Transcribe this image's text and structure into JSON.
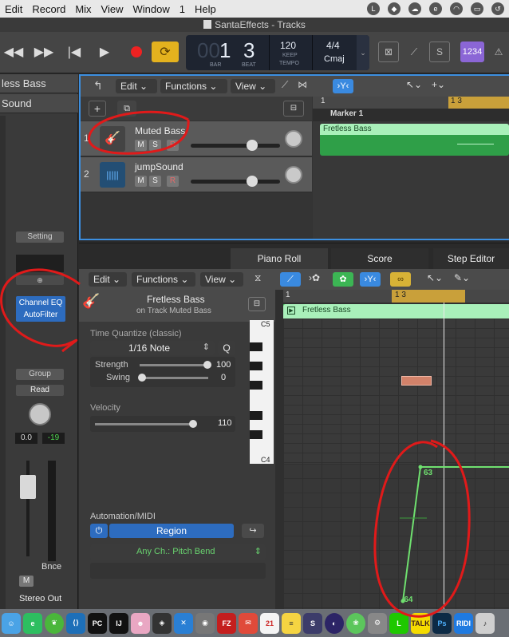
{
  "menubar": {
    "items": [
      "Edit",
      "Record",
      "Mix",
      "View",
      "Window",
      "1",
      "Help"
    ]
  },
  "window": {
    "title": "SantaEffects - Tracks"
  },
  "transport": {
    "bar_dim": "00",
    "bar": "1",
    "beat": "3",
    "bar_label": "BAR",
    "beat_label": "BEAT",
    "tempo": "120",
    "keep": "KEEP",
    "tempo_label": "TEMPO",
    "signature": "4/4",
    "key": "Cmaj",
    "count_in": "1234"
  },
  "inspector": {
    "track_header": "less Bass",
    "sub_header": "Sound",
    "setting": "Setting",
    "plugin_1": "Channel EQ",
    "plugin_2": "AutoFilter",
    "group": "Group",
    "automation_mode": "Read",
    "volume": "0.0",
    "peak": "-19",
    "bounce": "Bnce",
    "mute": "M",
    "output": "Stereo Out"
  },
  "tracks_toolbar": {
    "edit": "Edit",
    "functions": "Functions",
    "view": "View"
  },
  "tracks": [
    {
      "num": "1",
      "name": "Muted Bass",
      "m": "M",
      "s": "S",
      "r": "R",
      "volume": 0.72
    },
    {
      "num": "2",
      "name": "jumpSound",
      "m": "M",
      "s": "S",
      "r": "R",
      "volume": 0.72
    }
  ],
  "ruler": {
    "bar1": "1",
    "bar13": "1 3",
    "marker": "Marker 1"
  },
  "regions": {
    "top": "Fretless Bass",
    "editor": "Fretless Bass"
  },
  "editor": {
    "tabs": [
      "Piano Roll",
      "Score",
      "Step Editor"
    ],
    "edit": "Edit",
    "functions": "Functions",
    "view": "View",
    "region_name": "Fretless Bass",
    "region_sub": "on Track Muted Bass",
    "time_quantize_label": "Time Quantize (classic)",
    "quantize_value": "1/16 Note",
    "q": "Q",
    "strength_label": "Strength",
    "strength_value": "100",
    "swing_label": "Swing",
    "swing_value": "0",
    "velocity_label": "Velocity",
    "velocity_value": "110",
    "automation_label": "Automation/MIDI",
    "region_button": "Region",
    "channel": "Any Ch.: Pitch Bend",
    "key_c5": "C5",
    "key_c4": "C4",
    "ruler_1": "1",
    "ruler_13": "1 3",
    "bend_high": "63",
    "bend_low": "-64"
  },
  "dock": {
    "icons": [
      "finder",
      "evernote",
      "leaf",
      "vscode",
      "pycharm",
      "intellij",
      "anime",
      "unity",
      "xcode",
      "photo",
      "filezilla",
      "pdf",
      "calendar",
      "notes",
      "sublime",
      "eclipse",
      "chrome",
      "line",
      "kakao",
      "ps",
      "ridi",
      "music"
    ]
  }
}
